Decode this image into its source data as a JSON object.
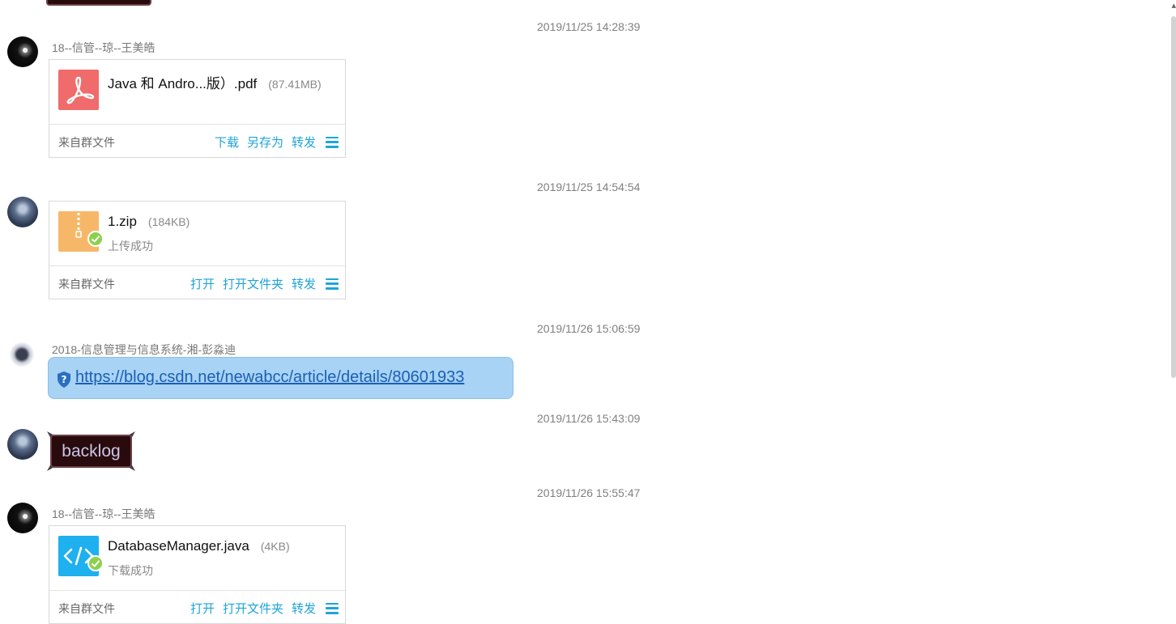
{
  "scrollbar": {
    "up_arrow": "▴"
  },
  "top_sticker_partial": {
    "visible": true
  },
  "messages": [
    {
      "timestamp": "2019/11/25 14:28:39",
      "sender": "18--信管--琼--王美皓",
      "avatar": "dark-avatar",
      "file": {
        "icon": "pdf-icon",
        "name": "Java 和 Andro...版）.pdf",
        "size": "(87.41MB)",
        "status": "",
        "origin": "来自群文件",
        "actions": [
          "下载",
          "另存为",
          "转发"
        ]
      }
    },
    {
      "timestamp": "2019/11/25 14:54:54",
      "sender": "",
      "avatar": "blue-avatar",
      "file": {
        "icon": "zip-icon",
        "name": "1.zip",
        "size": "(184KB)",
        "status": "上传成功",
        "origin": "来自群文件",
        "actions": [
          "打开",
          "打开文件夹",
          "转发"
        ]
      }
    },
    {
      "timestamp": "2019/11/26 15:06:59",
      "sender": "2018-信息管理与信息系统-湘-彭淼迪",
      "avatar": "light-avatar",
      "link": "https://blog.csdn.net/newabcc/article/details/80601933"
    },
    {
      "timestamp": "2019/11/26 15:43:09",
      "sender": "",
      "avatar": "blue-avatar",
      "sticker_text": "backlog"
    },
    {
      "timestamp": "2019/11/26 15:55:47",
      "sender": "18--信管--琼--王美皓",
      "avatar": "dark-avatar",
      "file": {
        "icon": "code-icon",
        "name": "DatabaseManager.java",
        "size": "(4KB)",
        "status": "下载成功",
        "origin": "来自群文件",
        "actions": [
          "打开",
          "打开文件夹",
          "转发"
        ]
      }
    }
  ]
}
